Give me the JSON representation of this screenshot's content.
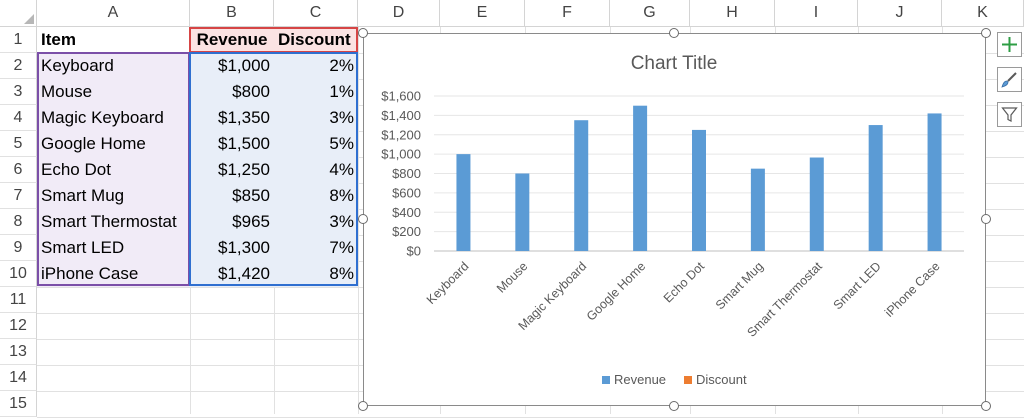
{
  "columns": [
    "A",
    "B",
    "C",
    "D",
    "E",
    "F",
    "G",
    "H",
    "I",
    "J",
    "K"
  ],
  "rows": [
    "1",
    "2",
    "3",
    "4",
    "5",
    "6",
    "7",
    "8",
    "9",
    "10",
    "11",
    "12",
    "13",
    "14",
    "15"
  ],
  "table": {
    "headers": [
      "Item",
      "Revenue",
      "Discount"
    ],
    "rows": [
      [
        "Keyboard",
        "$1,000",
        "2%"
      ],
      [
        "Mouse",
        "$800",
        "1%"
      ],
      [
        "Magic Keyboard",
        "$1,350",
        "3%"
      ],
      [
        "Google Home",
        "$1,500",
        "5%"
      ],
      [
        "Echo Dot",
        "$1,250",
        "4%"
      ],
      [
        "Smart Mug",
        "$850",
        "8%"
      ],
      [
        "Smart Thermostat",
        "$965",
        "3%"
      ],
      [
        "Smart LED",
        "$1,300",
        "7%"
      ],
      [
        "iPhone Case",
        "$1,420",
        "8%"
      ]
    ]
  },
  "chart_data": {
    "type": "bar",
    "title": "Chart Title",
    "categories": [
      "Keyboard",
      "Mouse",
      "Magic Keyboard",
      "Google Home",
      "Echo Dot",
      "Smart Mug",
      "Smart Thermostat",
      "Smart LED",
      "iPhone Case"
    ],
    "series": [
      {
        "name": "Revenue",
        "values": [
          1000,
          800,
          1350,
          1500,
          1250,
          850,
          965,
          1300,
          1420
        ],
        "color": "#5b9bd5"
      },
      {
        "name": "Discount",
        "values": [
          0.02,
          0.01,
          0.03,
          0.05,
          0.04,
          0.08,
          0.03,
          0.07,
          0.08
        ],
        "color": "#ed7d31"
      }
    ],
    "ylim": [
      0,
      1600
    ],
    "yticks": [
      "$0",
      "$200",
      "$400",
      "$600",
      "$800",
      "$1,000",
      "$1,200",
      "$1,400",
      "$1,600"
    ],
    "grid": true,
    "legend": "bottom"
  },
  "chart_tools": {
    "icons": [
      "plus-icon",
      "brush-icon",
      "filter-icon"
    ],
    "plus_color": "#2e9e44"
  }
}
